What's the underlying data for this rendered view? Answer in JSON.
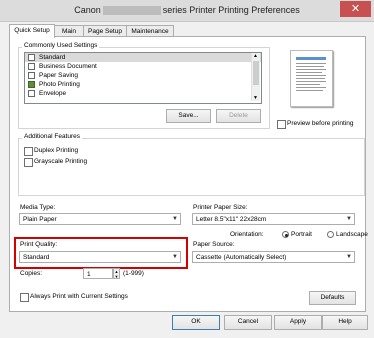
{
  "window": {
    "title_left": "Canon",
    "title_right": "series Printer Printing Preferences",
    "close_glyph": "✕"
  },
  "tabs": [
    {
      "label": "Quick Setup",
      "active": true
    },
    {
      "label": "Main",
      "active": false
    },
    {
      "label": "Page Setup",
      "active": false
    },
    {
      "label": "Maintenance",
      "active": false
    }
  ],
  "commonly_used": {
    "label": "Commonly Used Settings",
    "items": [
      "Standard",
      "Business Document",
      "Paper Saving",
      "Photo Printing",
      "Envelope"
    ],
    "selected_index": 0,
    "save_label": "Save...",
    "delete_label": "Delete"
  },
  "preview": {
    "checkbox_label": "Preview before printing",
    "checked": false
  },
  "additional": {
    "label": "Additional Features",
    "items": [
      {
        "label": "Duplex Printing",
        "checked": false
      },
      {
        "label": "Grayscale Printing",
        "checked": false
      }
    ]
  },
  "media_type": {
    "label": "Media Type:",
    "value": "Plain Paper"
  },
  "printer_paper_size": {
    "label": "Printer Paper Size:",
    "value": "Letter 8.5\"x11\" 22x28cm"
  },
  "orientation": {
    "label": "Orientation:",
    "portrait": "Portrait",
    "landscape": "Landscape",
    "selected": "Portrait"
  },
  "print_quality": {
    "label": "Print Quality:",
    "value": "Standard"
  },
  "paper_source": {
    "label": "Paper Source:",
    "value": "Cassette (Automatically Select)"
  },
  "copies": {
    "label": "Copies:",
    "value": "1",
    "range": "(1-999)"
  },
  "always_print": {
    "label": "Always Print with Current Settings",
    "checked": false
  },
  "defaults_label": "Defaults",
  "footer": {
    "ok": "OK",
    "cancel": "Cancel",
    "apply": "Apply",
    "help": "Help"
  },
  "colors": {
    "highlight_border": "#d40000",
    "close_button": "#c75050"
  }
}
